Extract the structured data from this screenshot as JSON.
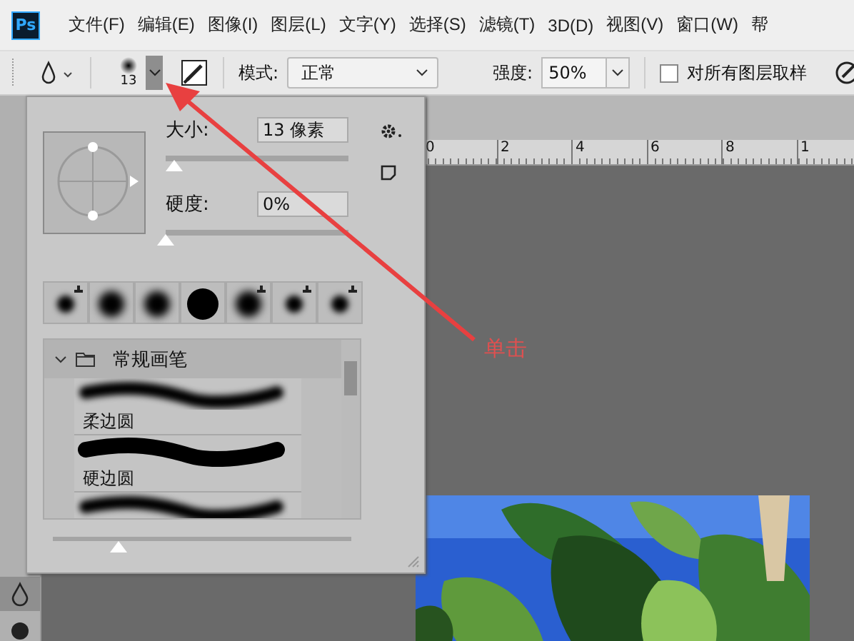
{
  "app_logo": "Ps",
  "menu": [
    "文件(F)",
    "编辑(E)",
    "图像(I)",
    "图层(L)",
    "文字(Y)",
    "选择(S)",
    "滤镜(T)",
    "3D(D)",
    "视图(V)",
    "窗口(W)",
    "帮"
  ],
  "options_bar": {
    "brush_size": "13",
    "brush_picker_open": true,
    "mode_label": "模式:",
    "mode_value": "正常",
    "strength_label": "强度:",
    "strength_value": "50%",
    "sample_all_layers": {
      "label": "对所有图层取样",
      "checked": false
    }
  },
  "brush_panel": {
    "size_label": "大小:",
    "size_value": "13 像素",
    "size_slider": {
      "level": 0.05
    },
    "hardness_label": "硬度:",
    "hardness_value": "0%",
    "hardness_slider": {
      "level": 0
    },
    "presets": [
      {
        "kind": "soft-small",
        "badge": true
      },
      {
        "kind": "soft",
        "badge": false
      },
      {
        "kind": "soft",
        "badge": false
      },
      {
        "kind": "hard",
        "badge": false
      },
      {
        "kind": "soft",
        "badge": true
      },
      {
        "kind": "soft-small",
        "badge": true
      },
      {
        "kind": "soft-small",
        "badge": true
      }
    ],
    "group": {
      "name": "常规画笔",
      "expanded": true,
      "items": [
        {
          "name": "柔边圆",
          "kind": "soft"
        },
        {
          "name": "硬边圆",
          "kind": "hard"
        },
        {
          "kind": "soft"
        }
      ]
    },
    "preview_slider": {
      "level": 0.22
    }
  },
  "ruler": [
    "0",
    "2",
    "4",
    "6",
    "8",
    "1"
  ],
  "annotation": "单击"
}
